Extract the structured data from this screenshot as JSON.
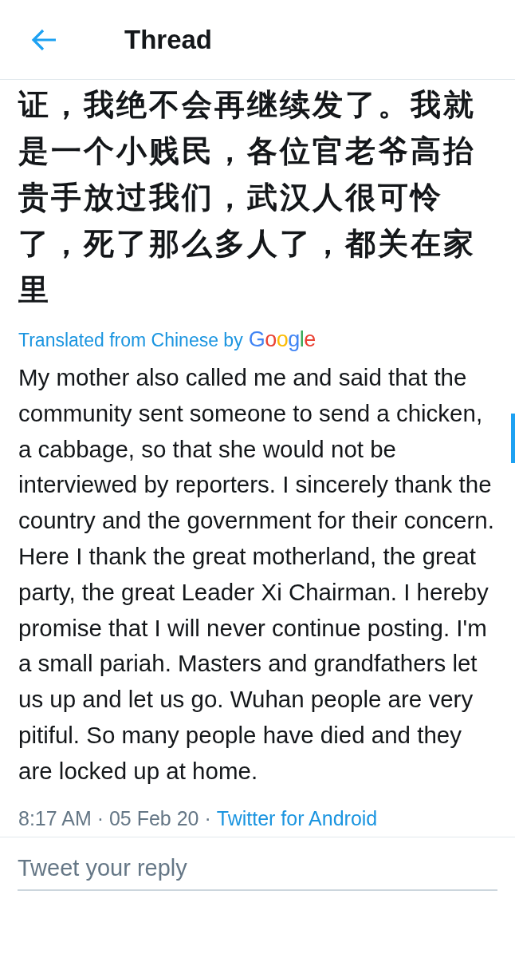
{
  "header": {
    "title": "Thread"
  },
  "tweet": {
    "original_text": "证，我绝不会再继续发了。我就是一个小贱民，各位官老爷高抬贵手放过我们，武汉人很可怜了，死了那么多人了，都关在家里",
    "translation_label": "Translated from Chinese by",
    "translation_provider": "Google",
    "translated_text": "My mother also called me and said that the community sent someone to send a chicken, a cabbage, so that she would not be interviewed by reporters. I sincerely thank the country and the government for their concern. Here I thank the great motherland, the great party, the great Leader Xi Chairman. I hereby promise that I will never continue posting. I'm a small pariah. Masters and grandfathers let us up and let us go. Wuhan people are very pitiful. So many people have died and they are locked up at home.",
    "timestamp": "8:17 AM · 05 Feb 20 ·",
    "source": "Twitter for Android"
  },
  "reply": {
    "placeholder": "Tweet your reply"
  }
}
